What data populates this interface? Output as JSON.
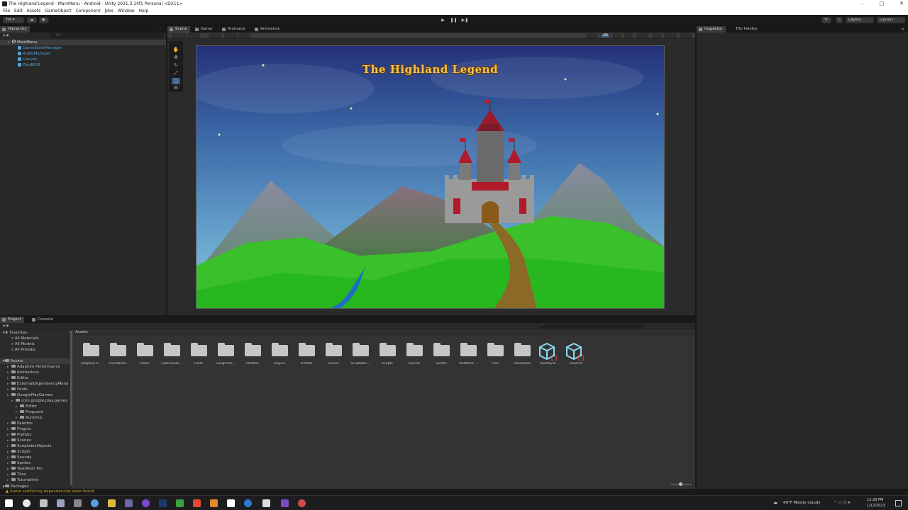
{
  "window": {
    "title": "The Highland Legend - MainMenu - Android - Unity 2021.3.14f1 Personal <DX11>",
    "controls": [
      "–",
      "□",
      "✕"
    ]
  },
  "menu": [
    "File",
    "Edit",
    "Assets",
    "GameObject",
    "Component",
    "Jobs",
    "Window",
    "Help"
  ],
  "toolbar": {
    "account": "TM ▾",
    "layers": "Layers",
    "layout": "Layout",
    "play": "▶",
    "pause": "❚❚",
    "step": "▶❚"
  },
  "hierarchy": {
    "tab": "Hierarchy",
    "search_placeholder": "All",
    "scene": "MainMenu",
    "objects": [
      "GameStateManager",
      "AudioManager",
      "Canvas",
      "PlayBGM"
    ]
  },
  "center_tabs": [
    "Scene",
    "Game",
    "Animator",
    "Animation"
  ],
  "scene_toolbar": {
    "mode_2d": "2D"
  },
  "game_view": {
    "title": "The Highland Legend"
  },
  "inspector": {
    "tabs": [
      "Inspector",
      "Tile Palette"
    ]
  },
  "project": {
    "tabs": [
      "Project",
      "Console"
    ],
    "favorites_label": "Favorites",
    "favorites": [
      "All Materials",
      "All Models",
      "All Prefabs"
    ],
    "assets_label": "Assets",
    "tree": [
      {
        "label": "Adaptive Performance",
        "depth": 1
      },
      {
        "label": "Animations",
        "depth": 1
      },
      {
        "label": "Editor",
        "depth": 1
      },
      {
        "label": "ExternalDependencyMana",
        "depth": 1
      },
      {
        "label": "Fonts",
        "depth": 1
      },
      {
        "label": "GooglePlayGames",
        "depth": 1
      },
      {
        "label": "com.google.play.games",
        "depth": 2
      },
      {
        "label": "Editor",
        "depth": 3
      },
      {
        "label": "Proguard",
        "depth": 3
      },
      {
        "label": "Runtime",
        "depth": 3
      },
      {
        "label": "Palettes",
        "depth": 1
      },
      {
        "label": "Plugins",
        "depth": 1
      },
      {
        "label": "Prefabs",
        "depth": 1
      },
      {
        "label": "Scenes",
        "depth": 1
      },
      {
        "label": "ScriptableObjects",
        "depth": 1
      },
      {
        "label": "Scripts",
        "depth": 1
      },
      {
        "label": "Sounds",
        "depth": 1
      },
      {
        "label": "Sprites",
        "depth": 1
      },
      {
        "label": "TextMesh Pro",
        "depth": 1
      },
      {
        "label": "Tiles",
        "depth": 1
      },
      {
        "label": "TutorialInfo",
        "depth": 1
      }
    ],
    "packages_label": "Packages",
    "breadcrumb": "Assets",
    "grid": [
      {
        "label": "Adaptive P...",
        "kind": "folder"
      },
      {
        "label": "Animations",
        "kind": "folder"
      },
      {
        "label": "Editor",
        "kind": "folder"
      },
      {
        "label": "ExternalDe...",
        "kind": "folder"
      },
      {
        "label": "Fonts",
        "kind": "folder"
      },
      {
        "label": "GooglePla...",
        "kind": "folder"
      },
      {
        "label": "Palettes",
        "kind": "folder"
      },
      {
        "label": "Plugins",
        "kind": "folder"
      },
      {
        "label": "Prefabs",
        "kind": "folder"
      },
      {
        "label": "Scenes",
        "kind": "folder"
      },
      {
        "label": "Scriptable...",
        "kind": "folder"
      },
      {
        "label": "Scripts",
        "kind": "folder"
      },
      {
        "label": "Sounds",
        "kind": "folder"
      },
      {
        "label": "Sprites",
        "kind": "folder"
      },
      {
        "label": "TextMesh ...",
        "kind": "folder"
      },
      {
        "label": "Tiles",
        "kind": "folder"
      },
      {
        "label": "TutorialInfo",
        "kind": "folder"
      },
      {
        "label": "InputSyst...",
        "kind": "package"
      },
      {
        "label": "Readme",
        "kind": "package"
      }
    ]
  },
  "status": {
    "warning": "Some conflicting dependencies were found."
  },
  "taskbar": {
    "weather": "49°F  Mostly cloudy",
    "time": "12:28 PM",
    "date": "1/12/2023"
  },
  "colors": {
    "panel": "#282828",
    "toolbar": "#191919",
    "accent_blue": "#4ea5d9",
    "title_gold": "#f0c64a",
    "warning": "#c8a42a"
  }
}
